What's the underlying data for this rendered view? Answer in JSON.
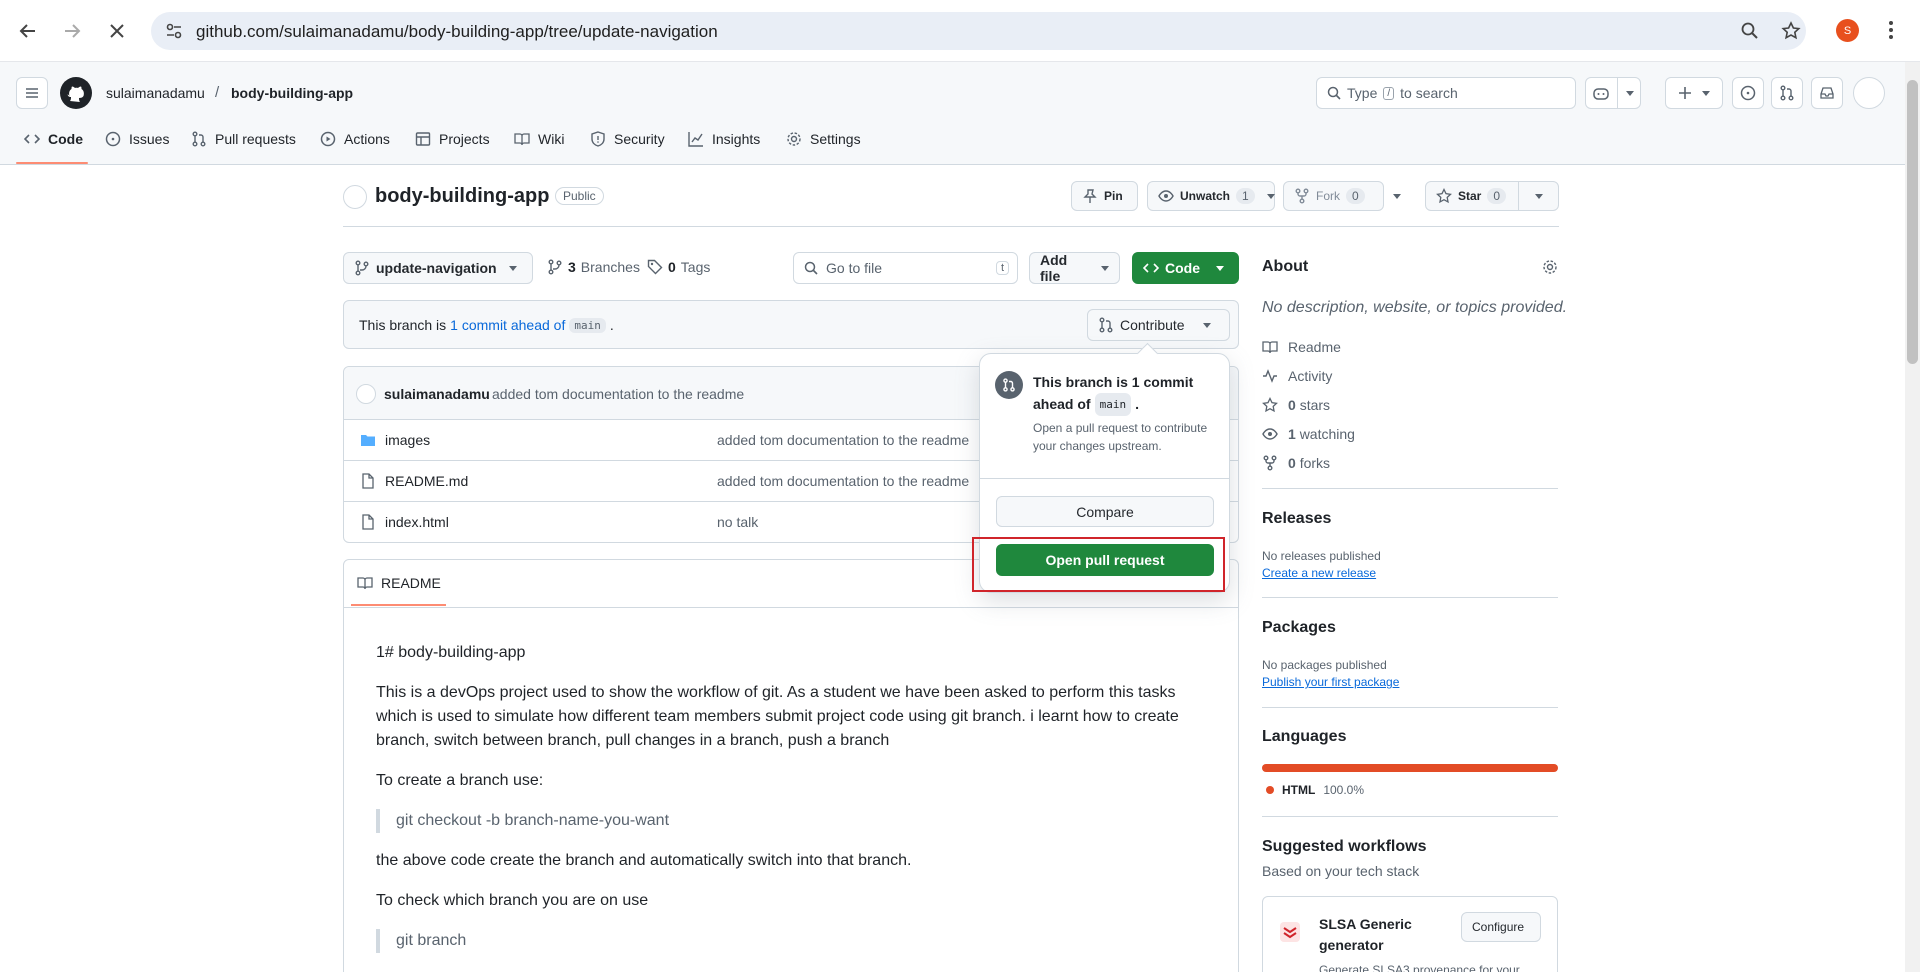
{
  "browser": {
    "url": "github.com/sulaimanadamu/body-building-app/tree/update-navigation",
    "profile_initial": "S"
  },
  "header": {
    "owner": "sulaimanadamu",
    "separator": "/",
    "repo": "body-building-app",
    "search_prefix": "Type",
    "search_key": "/",
    "search_suffix": "to search"
  },
  "repo_nav": {
    "tabs": [
      {
        "label": "Code",
        "icon": "code-icon",
        "active": true
      },
      {
        "label": "Issues",
        "icon": "issue-icon"
      },
      {
        "label": "Pull requests",
        "icon": "pull-request-icon"
      },
      {
        "label": "Actions",
        "icon": "actions-icon"
      },
      {
        "label": "Projects",
        "icon": "table-icon"
      },
      {
        "label": "Wiki",
        "icon": "book-icon"
      },
      {
        "label": "Security",
        "icon": "shield-icon"
      },
      {
        "label": "Insights",
        "icon": "graph-icon"
      },
      {
        "label": "Settings",
        "icon": "gear-icon"
      }
    ]
  },
  "repo": {
    "name": "body-building-app",
    "visibility": "Public",
    "pin_label": "Pin",
    "unwatch_label": "Unwatch",
    "unwatch_count": "1",
    "fork_label": "Fork",
    "fork_count": "0",
    "star_label": "Star",
    "star_count": "0"
  },
  "toolbar": {
    "branch": "update-navigation",
    "branches_count": "3",
    "branches_label": "Branches",
    "tags_count": "0",
    "tags_label": "Tags",
    "goto_placeholder": "Go to file",
    "goto_key": "t",
    "add_file_label": "Add file",
    "code_label": "Code"
  },
  "branch_status": {
    "prefix": "This branch is",
    "link": "1 commit ahead of",
    "base": "main",
    "suffix": ".",
    "contribute_label": "Contribute"
  },
  "commit": {
    "author": "sulaimanadamu",
    "message": "added tom documentation to the readme"
  },
  "files": [
    {
      "name": "images",
      "type": "folder",
      "message": "added tom documentation to the readme"
    },
    {
      "name": "README.md",
      "type": "file",
      "message": "added tom documentation to the readme"
    },
    {
      "name": "index.html",
      "type": "file",
      "message": "no talk"
    }
  ],
  "readme": {
    "tab_label": "README",
    "title": "1# body-building-app",
    "para1_line1": "This is a devOps project used to show the workflow of git. As a student we have been asked to perform this tasks",
    "para1_line2": "which is used to simulate how different team members submit project code using git branch. i learnt how to create",
    "para1_line3": "branch, switch between branch, pull changes in a branch, push a branch",
    "create_intro": "To create a branch use:",
    "create_cmd": "git checkout -b branch-name-you-want",
    "create_note": "the above code create the branch and automatically switch into that branch.",
    "check_intro": "To check which branch you are on use",
    "check_cmd": "git branch"
  },
  "popover": {
    "title_line1": "This branch is 1 commit",
    "title_line2_prefix": "ahead of",
    "title_base": "main",
    "title_suffix": ".",
    "desc_line1": "Open a pull request to contribute",
    "desc_line2": "your changes upstream.",
    "compare_label": "Compare",
    "open_pr_label": "Open pull request"
  },
  "about": {
    "heading": "About",
    "description": "No description, website, or topics provided.",
    "readme": "Readme",
    "activity": "Activity",
    "stars_count": "0",
    "stars_label": "stars",
    "watching_count": "1",
    "watching_label": "watching",
    "forks_count": "0",
    "forks_label": "forks"
  },
  "releases": {
    "heading": "Releases",
    "empty": "No releases published",
    "link": "Create a new release"
  },
  "packages": {
    "heading": "Packages",
    "empty": "No packages published",
    "link": "Publish your first package"
  },
  "languages": {
    "heading": "Languages",
    "items": [
      {
        "name": "HTML",
        "percent": "100.0%",
        "fraction": 1.0,
        "color": "#e34c26"
      }
    ]
  },
  "workflows": {
    "heading": "Suggested workflows",
    "subheading": "Based on your tech stack",
    "item_name_line1": "SLSA Generic",
    "item_name_line2": "generator",
    "item_desc": "Generate SLSA3 provenance for your",
    "configure_label": "Configure"
  },
  "colors": {
    "accent": "#0969da",
    "primary_button": "#1f883d",
    "active_tab_underline": "#fd8c73",
    "highlight_box": "#d0252b"
  }
}
